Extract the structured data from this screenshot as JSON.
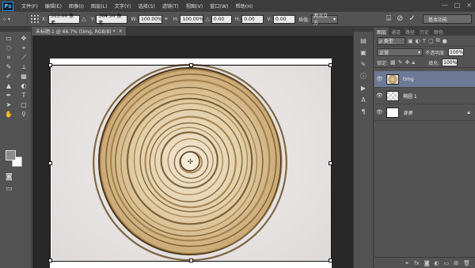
{
  "app": {
    "logo": "Ps"
  },
  "menu": [
    "文件(F)",
    "编辑(E)",
    "图像(I)",
    "图层(L)",
    "文字(Y)",
    "选择(S)",
    "滤镜(T)",
    "视图(V)",
    "窗口(W)",
    "帮助(H)"
  ],
  "window_controls": [
    "—",
    "□",
    "×"
  ],
  "options_bar": {
    "tool_glyph": "⊹",
    "x_label": "X:",
    "x_value": "513.00 像素",
    "y_label": "Y:",
    "y_value": "384.50 像素",
    "w_label": "W:",
    "w_value": "100.00%",
    "h_label": "H:",
    "h_value": "100.00%",
    "angle_value": "0.00",
    "hskew_label": "H:",
    "hskew_value": "0.00",
    "vskew_label": "V:",
    "vskew_value": "0.00",
    "interp_label": "插值:",
    "interp_value": "两次立方",
    "warp_icon": "warp-icon",
    "cancel_icon": "cancel-icon",
    "commit_icon": "commit-icon",
    "workspace": "基本功能"
  },
  "document": {
    "tab_title": "未标题-1 @ 66.7% (timg, RGB/8) *",
    "close": "×"
  },
  "toolbox": {
    "tools": [
      "▭",
      "✥",
      "◌",
      "⌖",
      "⌗",
      "⟋",
      "✎",
      "⟂",
      "✐",
      "▦",
      "▲",
      "◐",
      "✒",
      "T",
      "➤",
      "▢",
      "✋",
      "⚲"
    ]
  },
  "layers_panel": {
    "tabs": [
      "图层",
      "通道",
      "路径",
      "历史",
      "颜色"
    ],
    "filter_label": "ρ 类型",
    "blend_mode": "正常",
    "opacity_label": "不透明度:",
    "opacity_value": "100%",
    "lock_label": "锁定:",
    "fill_label": "填充:",
    "fill_value": "100%",
    "layers": [
      {
        "name": "timg",
        "thumb": "ring",
        "selected": true,
        "italic": false,
        "locked": false
      },
      {
        "name": "椭圆 1",
        "thumb": "checker",
        "selected": false,
        "italic": false,
        "locked": false
      },
      {
        "name": "背景",
        "thumb": "white",
        "selected": false,
        "italic": true,
        "locked": true
      }
    ],
    "footer_icons": [
      "link-icon",
      "fx-icon",
      "mask-icon",
      "adjustment-icon",
      "group-icon",
      "new-layer-icon",
      "trash-icon"
    ]
  },
  "colors": {
    "foreground": "#8a8a8a",
    "background": "#ffffff",
    "selection": "#6d7994"
  }
}
